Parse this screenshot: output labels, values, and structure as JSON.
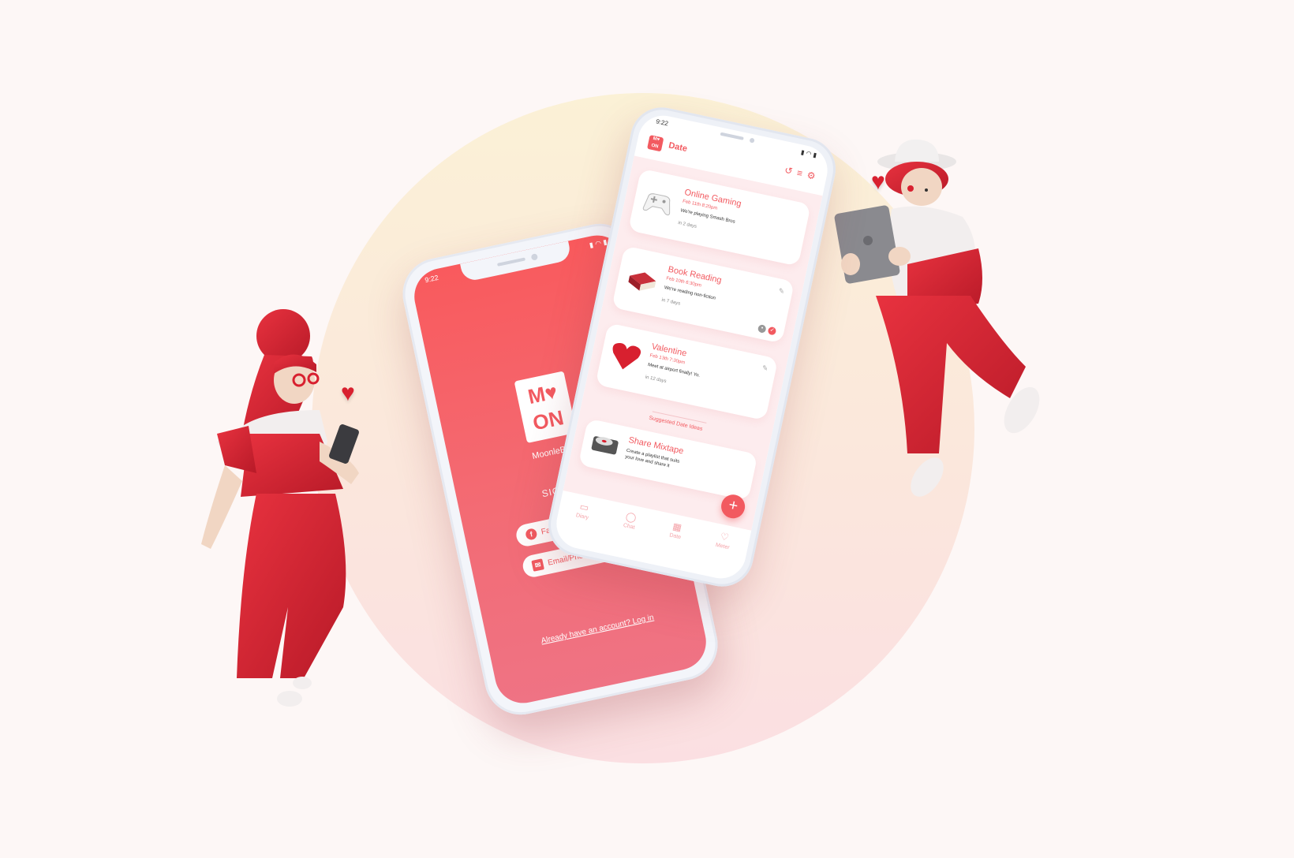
{
  "signup_phone": {
    "status_time": "9:22",
    "logo_line1": "M",
    "logo_heart": "♥",
    "logo_line2": "ON",
    "brand_name": "MoonleBack",
    "signup_label": "SIGN UP",
    "facebook_button": "Facebook",
    "email_button": "Email/Phone",
    "login_link": "Already have an account? Log in"
  },
  "date_phone": {
    "status_time": "9:22",
    "title": "Date",
    "cards": [
      {
        "title": "Online Gaming",
        "date": "Feb 11th 8:20pm",
        "desc": "We're playing Smash Bros",
        "when": "in 2 days"
      },
      {
        "title": "Book Reading",
        "date": "Feb 10th 6:30pm",
        "desc": "We're reading non-fiction",
        "when": "in 7 days"
      },
      {
        "title": "Valentine",
        "date": "Feb 13th 7:30pm",
        "desc": "Meet at airport finally! Yo.",
        "when": "in 12 days"
      }
    ],
    "suggested_label": "Suggested Date Ideas",
    "share": {
      "title": "Share Mixtape",
      "desc": "Create a playlist that suits your love and share it"
    },
    "tabs": [
      "Diary",
      "Chat",
      "Date",
      "Meter"
    ]
  },
  "colors": {
    "accent": "#f25a60",
    "heart": "#d8202f",
    "background": "#fdf7f6"
  }
}
